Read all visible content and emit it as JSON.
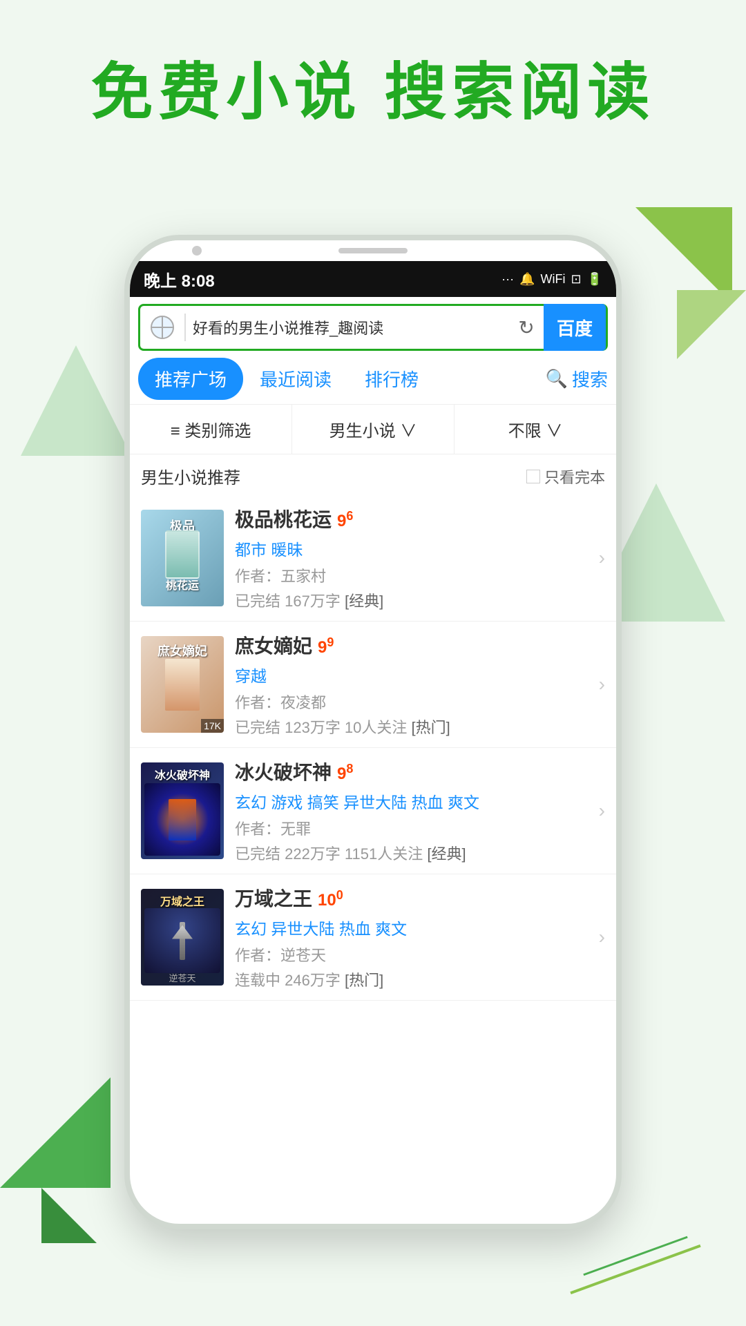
{
  "header": {
    "title": "免费小说  搜索阅读"
  },
  "statusBar": {
    "time": "晚上 8:08",
    "icons": "... 🔔 WiFi 🔋"
  },
  "browser": {
    "url": "好看的男生小说推荐_趣阅读",
    "baidu": "百度",
    "refreshIcon": "↻"
  },
  "tabs": [
    {
      "label": "推荐广场",
      "active": true
    },
    {
      "label": "最近阅读",
      "active": false
    },
    {
      "label": "排行榜",
      "active": false
    },
    {
      "label": "搜索",
      "active": false
    }
  ],
  "filters": [
    {
      "label": "≡ 类别筛选"
    },
    {
      "label": "男生小说 ∨"
    },
    {
      "label": "不限 ∨"
    }
  ],
  "sectionTitle": "男生小说推荐",
  "onlyComplete": "只看完本",
  "books": [
    {
      "title": "极品桃花运",
      "rating": "9",
      "ratingSup": "6",
      "genre": "都市 暖昧",
      "author": "作者：五家村",
      "meta": "已完结 167万字",
      "tag": "[经典]",
      "coverClass": "cover-1",
      "coverText": "极品桃花运"
    },
    {
      "title": "庶女嫡妃",
      "rating": "9",
      "ratingSup": "9",
      "genre": "穿越",
      "author": "作者：夜凌都",
      "meta": "已完结 123万字 10人关注",
      "tag": "[热门]",
      "coverClass": "cover-2",
      "coverText": "庶女嫡妃",
      "coverLabel": "17K"
    },
    {
      "title": "冰火破坏神",
      "rating": "9",
      "ratingSup": "8",
      "genre": "玄幻 游戏 搞笑 异世大陆 热血 爽文",
      "author": "作者：无罪",
      "meta": "已完结 222万字 1151人关注",
      "tag": "[经典]",
      "coverClass": "cover-3",
      "coverText": "冰火破坏神"
    },
    {
      "title": "万域之王",
      "rating": "10",
      "ratingSup": "0",
      "genre": "玄幻 异世大陆 热血 爽文",
      "author": "作者：逆苍天",
      "meta": "连载中 246万字",
      "tag": "[热门]",
      "coverClass": "cover-4",
      "coverText": "万域之王",
      "coverLabel": "逆苍天"
    }
  ]
}
